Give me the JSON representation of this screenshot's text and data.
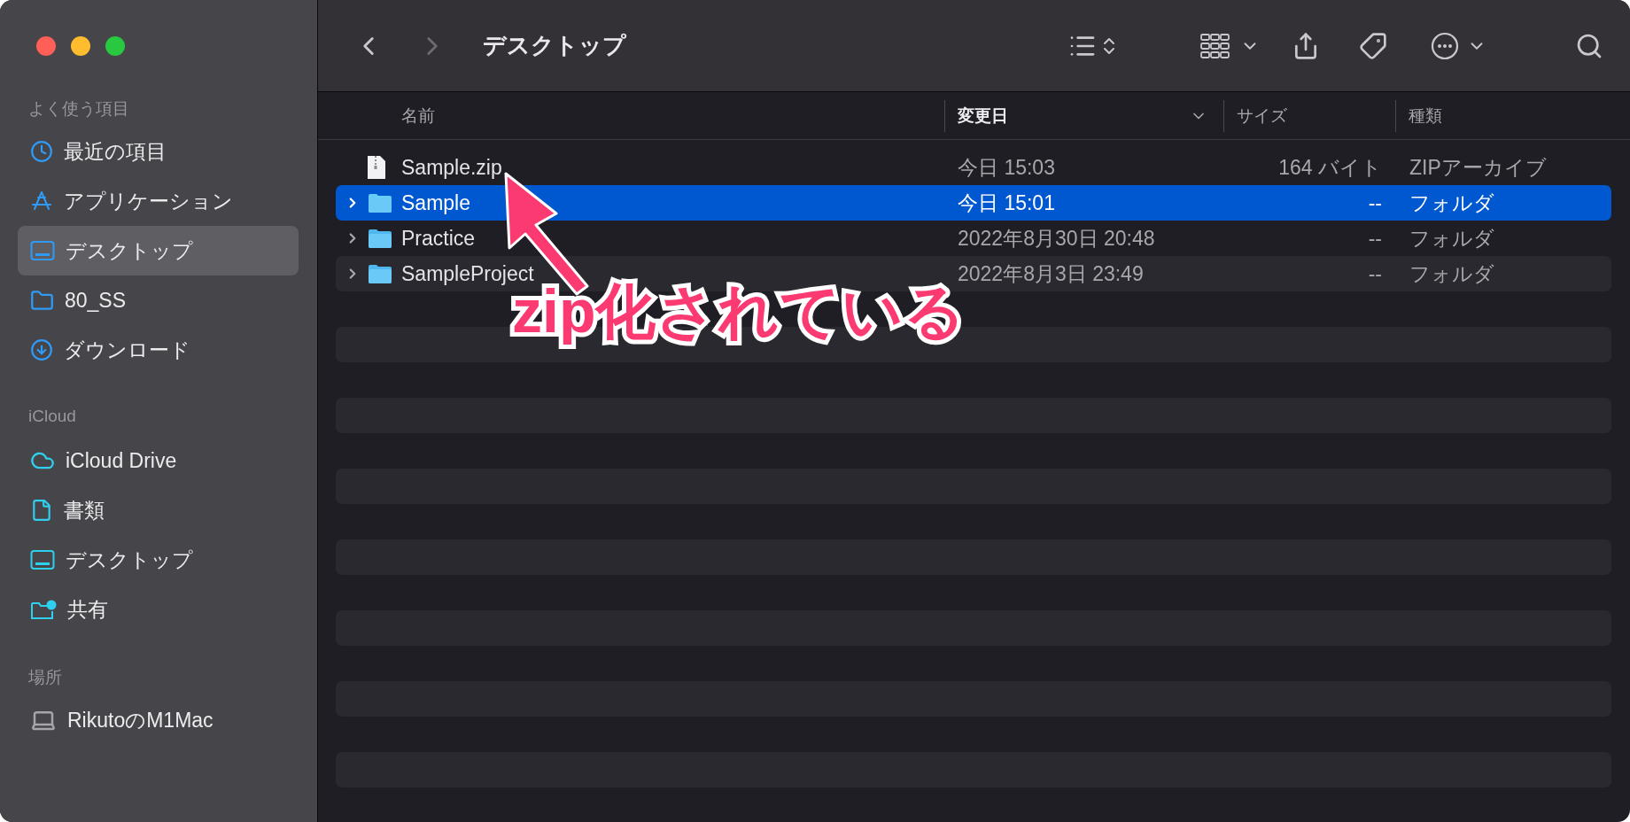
{
  "window": {
    "title": "デスクトップ"
  },
  "toolbar": {
    "back": {
      "disabled": false
    },
    "forward": {
      "disabled": true
    }
  },
  "sidebar": {
    "sections": [
      {
        "title": "よく使う項目",
        "items": [
          {
            "label": "最近の項目",
            "kind": "recent",
            "selected": false
          },
          {
            "label": "アプリケーション",
            "kind": "apps",
            "selected": false
          },
          {
            "label": "デスクトップ",
            "kind": "desktop",
            "selected": true
          },
          {
            "label": "80_SS",
            "kind": "folder",
            "selected": false
          },
          {
            "label": "ダウンロード",
            "kind": "download",
            "selected": false
          }
        ]
      },
      {
        "title": "iCloud",
        "items": [
          {
            "label": "iCloud Drive",
            "kind": "cloud",
            "selected": false
          },
          {
            "label": "書類",
            "kind": "document",
            "selected": false
          },
          {
            "label": "デスクトップ",
            "kind": "desktop-cloud",
            "selected": false
          },
          {
            "label": "共有",
            "kind": "shared",
            "selected": false
          }
        ]
      },
      {
        "title": "場所",
        "items": [
          {
            "label": "RikutoのM1Mac",
            "kind": "computer",
            "selected": false
          }
        ]
      }
    ]
  },
  "table": {
    "columns": [
      {
        "label": "名前",
        "sorted": false
      },
      {
        "label": "変更日",
        "sorted": true
      },
      {
        "label": "サイズ",
        "sorted": false
      },
      {
        "label": "種類",
        "sorted": false
      }
    ],
    "rows": [
      {
        "name": "Sample.zip",
        "modified": "今日 15:03",
        "size": "164 バイト",
        "category": "ZIPアーカイブ",
        "kind": "file",
        "selected": false
      },
      {
        "name": "Sample",
        "modified": "今日 15:01",
        "size": "--",
        "category": "フォルダ",
        "kind": "folder",
        "selected": true
      },
      {
        "name": "Practice",
        "modified": "2022年8月30日 20:48",
        "size": "--",
        "category": "フォルダ",
        "kind": "folder",
        "selected": false
      },
      {
        "name": "SampleProject",
        "modified": "2022年8月3日 23:49",
        "size": "--",
        "category": "フォルダ",
        "kind": "folder",
        "selected": false
      }
    ]
  },
  "annotation": {
    "text": "zip化されている"
  }
}
